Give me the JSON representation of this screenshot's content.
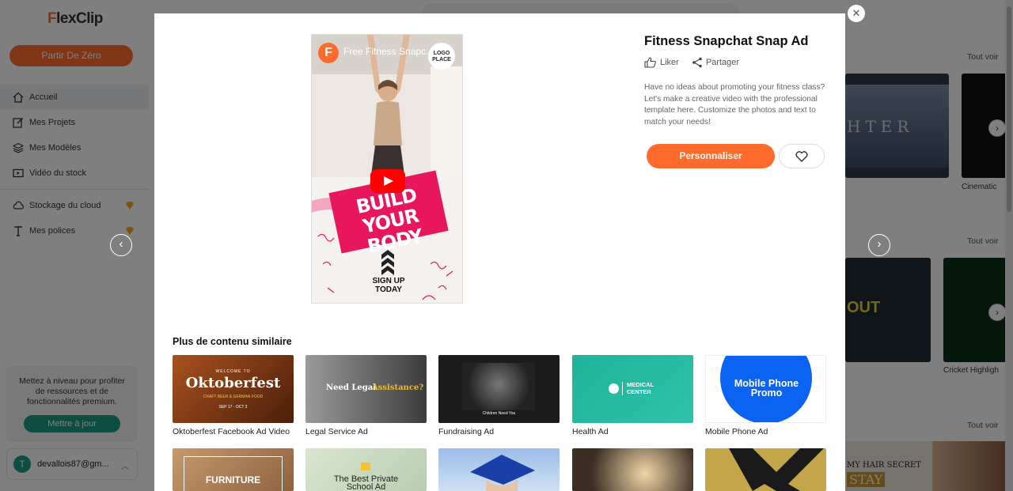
{
  "app": {
    "logo_f": "F",
    "logo_rest": "lexClip",
    "start_button": "Partir De Zéro",
    "nav": [
      {
        "label": "Accueil",
        "icon": "home-icon",
        "active": true
      },
      {
        "label": "Mes Projets",
        "icon": "edit-icon"
      },
      {
        "label": "Mes Modèles",
        "icon": "layers-icon"
      },
      {
        "label": "Vidéo du stock",
        "icon": "video-icon"
      },
      {
        "label": "Stockage du cloud",
        "icon": "cloud-icon",
        "premium": true
      },
      {
        "label": "Mes polices",
        "icon": "font-icon",
        "premium": true
      }
    ],
    "upgrade_text": "Mettez à niveau pour profiter de ressources et de fonctionnalités premium.",
    "upgrade_button": "Mettre à jour",
    "account_initial": "T",
    "account_email": "devallois87@gm...",
    "see_all": "Tout voir",
    "bg_captions": [
      "Cinematic",
      "Cricket Highligh"
    ],
    "bg_thumb_text": [
      "HTER",
      "OUT",
      "MY HAIR SECRET",
      "STAY"
    ]
  },
  "modal": {
    "video_title": "Free Fitness Snapc...",
    "video_logo": "F",
    "logo_place": "LOGO PLACE",
    "banner_text_1": "BUILD",
    "banner_text_2": "YOUR BODY",
    "signup_1": "SIGN UP",
    "signup_2": "TODAY",
    "title": "Fitness Snapchat Snap Ad",
    "like_label": "Liker",
    "share_label": "Partager",
    "description": "Have no ideas about promoting your fitness class? Let's make a creative video with the professional template here. Customize the photos and text to match your needs!",
    "customize_button": "Personnaliser",
    "similar_title": "Plus de contenu similaire",
    "similar": [
      {
        "caption": "Oktoberfest Facebook Ad Video",
        "thumb_text": "Oktoberfest",
        "thumb_sub": "WELCOME TO",
        "thumb_detail": "CRAFT BEER & GERMAN FOOD",
        "thumb_date": "SEP 17 - OCT 3",
        "bg": "#7a3a16"
      },
      {
        "caption": "Legal Service Ad",
        "thumb_text": "Need Legal",
        "thumb_accent": "Assistance?",
        "bg": "#555555"
      },
      {
        "caption": "Fundraising Ad",
        "thumb_text": "Children Need You",
        "bg": "#1b1b1b"
      },
      {
        "caption": "Health Ad",
        "thumb_text": "MEDICAL",
        "thumb_text2": "CENTER",
        "bg": "#24b59a"
      },
      {
        "caption": "Mobile Phone Ad",
        "thumb_text": "Mobile Phone",
        "thumb_text2": "Promo",
        "bg": "#ffffff"
      }
    ],
    "similar_row2": [
      {
        "thumb_text": "FURNITURE",
        "bg": "#b5845a"
      },
      {
        "thumb_text": "The Best Private",
        "thumb_text2": "School Ad",
        "bg": "#cfe0c6"
      },
      {
        "thumb_text": "",
        "bg": "#7fa8d8"
      },
      {
        "thumb_text": "",
        "bg": "#6b5a44"
      },
      {
        "thumb_text": "",
        "bg": "#b89a3a"
      }
    ]
  }
}
